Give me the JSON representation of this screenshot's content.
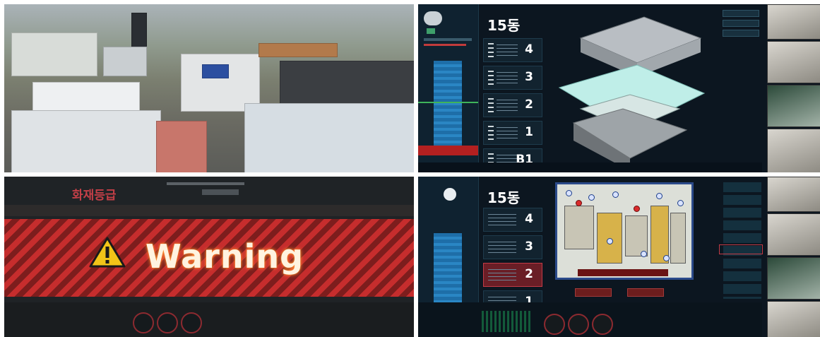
{
  "top_right": {
    "building_title": "15동",
    "floors": [
      "4",
      "3",
      "2",
      "1",
      "B1"
    ]
  },
  "bottom_left": {
    "fire_header": "화재등급",
    "warning_text": "Warning"
  },
  "bottom_right": {
    "building_title": "15동",
    "floors": [
      "4",
      "3",
      "2",
      "1"
    ],
    "active_floor": "2"
  },
  "colors": {
    "dashboard_bg": "#0c1620",
    "warning_red": "#c62d2d",
    "alert_red": "#b32020",
    "bar_blue": "#2a86c4"
  }
}
